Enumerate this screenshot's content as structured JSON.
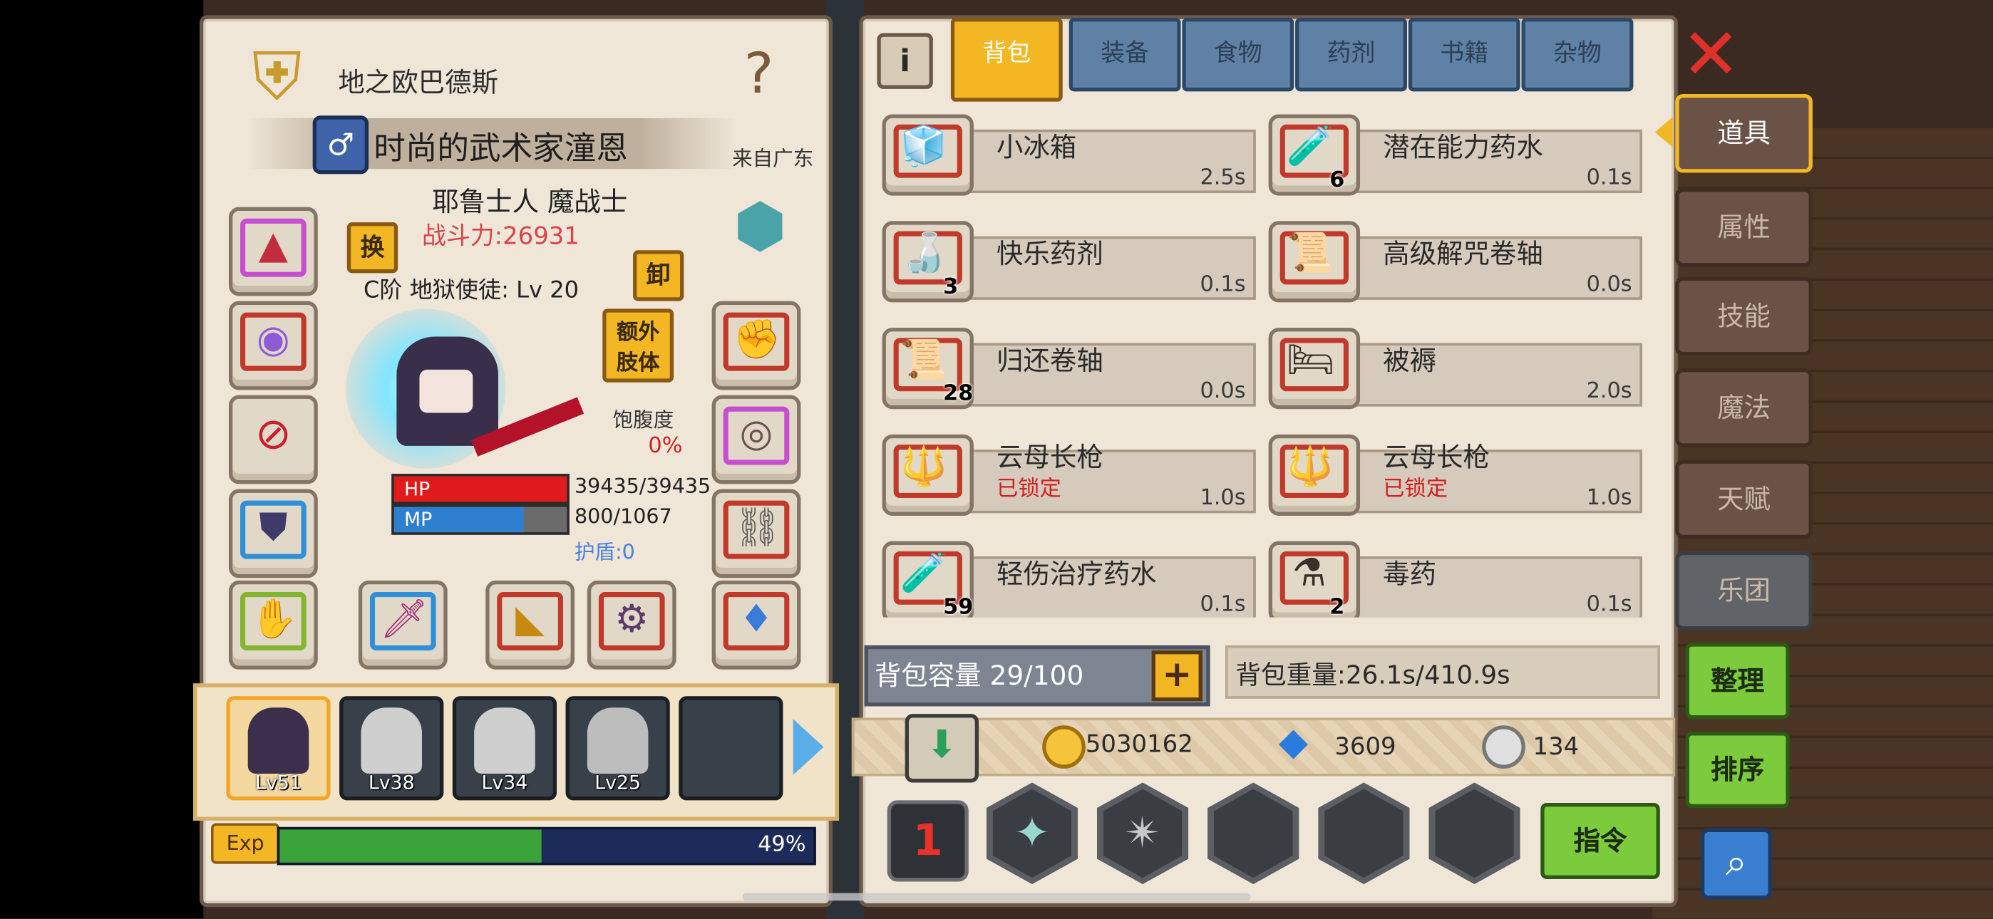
{
  "character": {
    "world_title": "地之欧巴德斯",
    "name": "时尚的武术家潼恩",
    "origin": "来自广东",
    "race_class": "耶鲁士人 魔战士",
    "power": "战斗力:26931",
    "swap_label": "换",
    "unequip_label": "卸",
    "rank_line": "C阶 地狱使徒: Lv 20",
    "extra_limb_label": "额外\n肢体",
    "satiety_label": "饱腹度",
    "satiety_value": "0%",
    "hp_label": "HP",
    "hp_value": "39435/39435",
    "hp_fraction": 1.0,
    "mp_label": "MP",
    "mp_value": "800/1067",
    "mp_fraction": 0.75,
    "shield": "护盾:0",
    "exp_label": "Exp",
    "exp_percent": "49%",
    "exp_fraction": 0.49
  },
  "party": [
    {
      "level": "Lv51"
    },
    {
      "level": "Lv38"
    },
    {
      "level": "Lv34"
    },
    {
      "level": "Lv25"
    },
    {
      "level": ""
    }
  ],
  "tabs": [
    "背包",
    "装备",
    "食物",
    "药剂",
    "书籍",
    "杂物"
  ],
  "items": [
    {
      "name": "小冰箱",
      "weight": "2.5s",
      "qty": "",
      "locked": "",
      "icon": "🧊"
    },
    {
      "name": "潜在能力药水",
      "weight": "0.1s",
      "qty": "6",
      "locked": "",
      "icon": "🧪"
    },
    {
      "name": "快乐药剂",
      "weight": "0.1s",
      "qty": "3",
      "locked": "",
      "icon": "🍶"
    },
    {
      "name": "高级解咒卷轴",
      "weight": "0.0s",
      "qty": "",
      "locked": "",
      "icon": "📜"
    },
    {
      "name": "归还卷轴",
      "weight": "0.0s",
      "qty": "28",
      "locked": "",
      "icon": "📜"
    },
    {
      "name": "被褥",
      "weight": "2.0s",
      "qty": "",
      "locked": "",
      "icon": "🛏"
    },
    {
      "name": "云母长枪",
      "weight": "1.0s",
      "qty": "",
      "locked": "已锁定",
      "icon": "🔱"
    },
    {
      "name": "云母长枪",
      "weight": "1.0s",
      "qty": "",
      "locked": "已锁定",
      "icon": "🔱"
    },
    {
      "name": "轻伤治疗药水",
      "weight": "0.1s",
      "qty": "59",
      "locked": "",
      "icon": "🧪"
    },
    {
      "name": "毒药",
      "weight": "0.1s",
      "qty": "2",
      "locked": "",
      "icon": "⚗"
    }
  ],
  "bag": {
    "capacity": "背包容量 29/100",
    "weight": "背包重量:26.1s/410.9s"
  },
  "currency": {
    "gold": "5030162",
    "gems": "3609",
    "silver": "134"
  },
  "side_tabs": [
    "道具",
    "属性",
    "技能",
    "魔法",
    "天赋",
    "乐团"
  ],
  "buttons": {
    "sort": "整理",
    "order": "排序",
    "command": "指令"
  },
  "colors": {
    "hp": "#e11b1b",
    "mp": "#2f7fd0",
    "exp": "#3aa43a",
    "power": "#d9434b",
    "locked": "#d21f1f",
    "shield": "#4a7fe0"
  }
}
